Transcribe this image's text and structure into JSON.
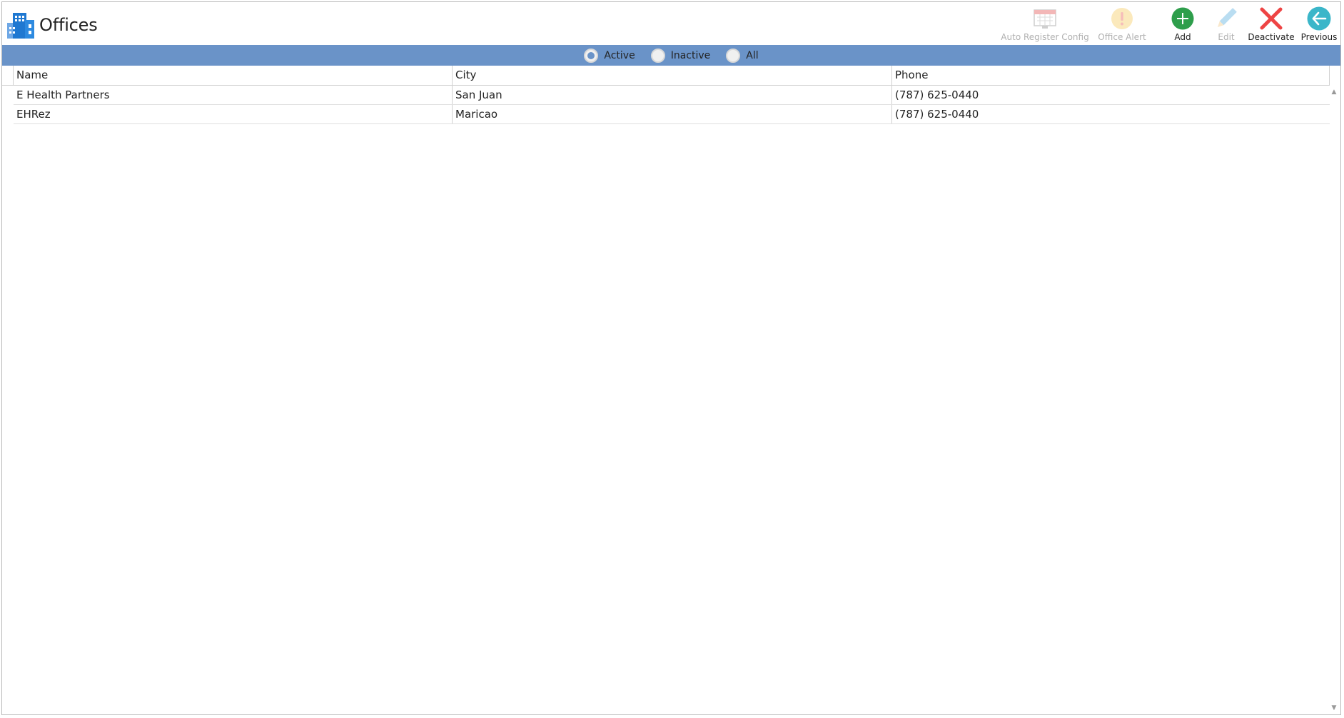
{
  "header": {
    "title": "Offices"
  },
  "toolbar": [
    {
      "label": "Auto Register Config",
      "icon": "calendar-config-icon",
      "enabled": false
    },
    {
      "label": "Office Alert",
      "icon": "alert-icon",
      "enabled": false
    },
    {
      "label": "Add",
      "icon": "add-icon",
      "enabled": true
    },
    {
      "label": "Edit",
      "icon": "pencil-icon",
      "enabled": false
    },
    {
      "label": "Deactivate",
      "icon": "close-icon",
      "enabled": true
    },
    {
      "label": "Previous",
      "icon": "back-arrow-icon",
      "enabled": true
    }
  ],
  "filter": {
    "options": [
      "Active",
      "Inactive",
      "All"
    ],
    "selected": "Active"
  },
  "grid": {
    "columns": [
      "Name",
      "City",
      "Phone"
    ],
    "rows": [
      [
        "E Health Partners",
        "San Juan",
        "(787) 625-0440"
      ],
      [
        "EHRez",
        "Maricao",
        "(787) 625-0440"
      ]
    ]
  },
  "colors": {
    "filter_bar": "#6a93c8",
    "add": "#2e9e4b",
    "deactivate": "#ee4444",
    "previous": "#3bb6c9"
  }
}
